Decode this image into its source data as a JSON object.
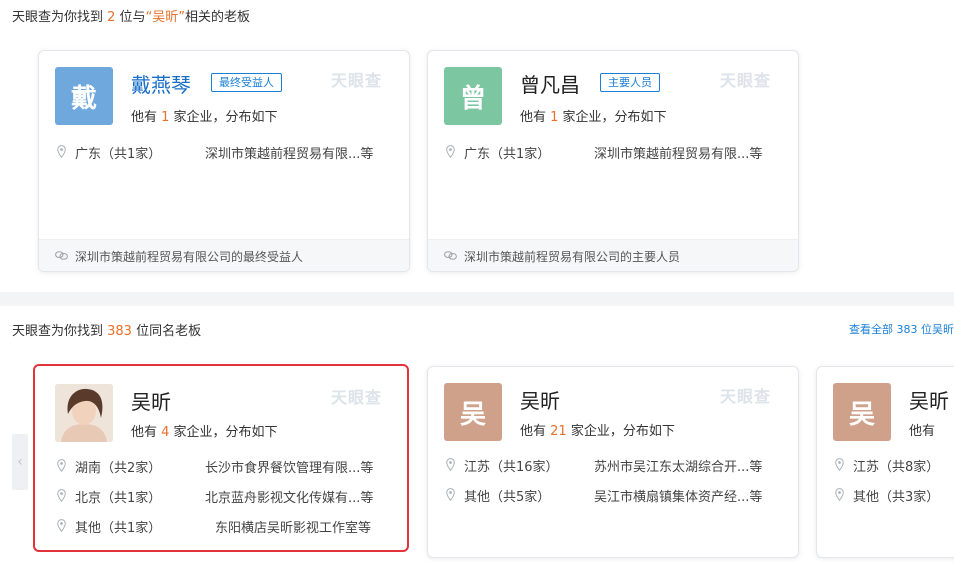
{
  "top_section": {
    "title_prefix": "天眼查为你找到 ",
    "title_count": "2",
    "title_middle": " 位与",
    "title_query": "“吴昕”",
    "title_suffix": "相关的老板"
  },
  "top_cards": [
    {
      "avatar_char": "戴",
      "name": "戴燕琴",
      "tag": "最终受益人",
      "watermark": "天眼查",
      "desc_prefix": "他有 ",
      "desc_count": "1",
      "desc_suffix": " 家企业，分布如下",
      "rows": [
        {
          "location": "广东（共1家）",
          "company": "深圳市策越前程贸易有限...等"
        }
      ],
      "footer": "深圳市策越前程贸易有限公司的最终受益人"
    },
    {
      "avatar_char": "曾",
      "name": "曾凡昌",
      "tag": "主要人员",
      "watermark": "天眼查",
      "desc_prefix": "他有 ",
      "desc_count": "1",
      "desc_suffix": " 家企业，分布如下",
      "rows": [
        {
          "location": "广东（共1家）",
          "company": "深圳市策越前程贸易有限...等"
        }
      ],
      "footer": "深圳市策越前程贸易有限公司的主要人员"
    }
  ],
  "bottom_section": {
    "title_prefix": "天眼查为你找到 ",
    "title_count": "383",
    "title_suffix": " 位同名老板",
    "see_all": "查看全部 383 位吴昕"
  },
  "bottom_cards": [
    {
      "avatar_char": "",
      "name": "吴昕",
      "watermark": "天眼查",
      "desc_prefix": "他有 ",
      "desc_count": "4",
      "desc_suffix": " 家企业，分布如下",
      "rows": [
        {
          "location": "湖南（共2家）",
          "company": "长沙市食界餐饮管理有限...等"
        },
        {
          "location": "北京（共1家）",
          "company": "北京蓝舟影视文化传媒有...等"
        },
        {
          "location": "其他（共1家）",
          "company": "东阳横店吴昕影视工作室等"
        }
      ]
    },
    {
      "avatar_char": "吴",
      "name": "吴昕",
      "watermark": "天眼查",
      "desc_prefix": "他有 ",
      "desc_count": "21",
      "desc_suffix": " 家企业，分布如下",
      "rows": [
        {
          "location": "江苏（共16家）",
          "company": "苏州市吴江东太湖综合开...等"
        },
        {
          "location": "其他（共5家）",
          "company": "吴江市横扇镇集体资产经...等"
        }
      ]
    },
    {
      "avatar_char": "吴",
      "name": "吴昕",
      "desc_prefix": "他有",
      "rows": [
        {
          "location": "江苏（共8家）"
        },
        {
          "location": "其他（共3家）"
        }
      ]
    }
  ],
  "colors": {
    "accent": "#e8702a",
    "link": "#1a7fd6",
    "selected_border": "#e0333a"
  }
}
